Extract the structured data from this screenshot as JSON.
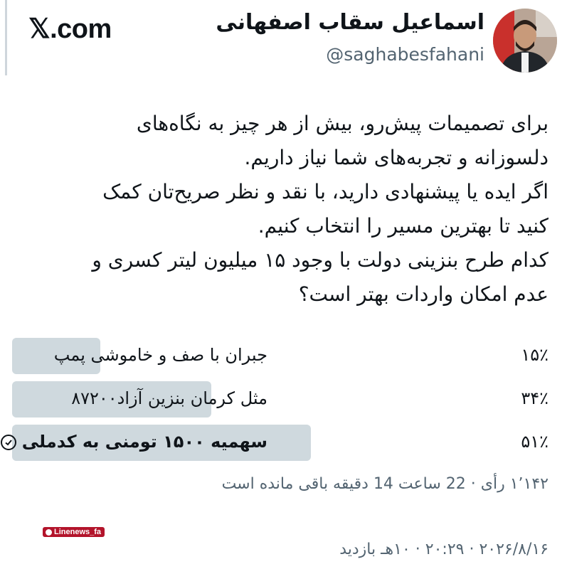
{
  "header": {
    "brand": "𝕏.com",
    "author_name": "اسماعیل سقاب اصفهانی",
    "author_handle": "@saghabesfahani"
  },
  "tweet": {
    "lines": [
      "برای تصمیمات پیش‌رو، بیش از هر چیز به نگاه‌های",
      "دلسوزانه و تجربه‌های شما نیاز داریم.",
      "اگر ایده یا پیشنهادی دارید، با نقد و نظر صریح‌تان کمک",
      "کنید تا بهترین مسیر را انتخاب کنیم.",
      "کدام طرح بنزینی دولت با وجود ۱۵ میلیون لیتر کسری و",
      "عدم امکان واردات بهتر است؟"
    ]
  },
  "poll": {
    "options": [
      {
        "label": "جبران با صف و خاموشی پمپ",
        "percent_text": "۱۵٪",
        "percent": 15,
        "selected": false
      },
      {
        "label": "مثل کرمان بنزین آزاد۸۷۲۰۰",
        "percent_text": "۳۴٪",
        "percent": 34,
        "selected": false
      },
      {
        "label": "سهمیه ۱۵۰۰ تومنی به کدملی",
        "percent_text": "۵۱٪",
        "percent": 51,
        "selected": true
      }
    ],
    "meta": "۱٬۱۴۲ رأی · 22 ساعت 14 دقیقه باقی مانده است"
  },
  "watermark": "Linenews_fa",
  "footer": "۲۰۲۶/۸/۱۶ · ۲۰:۲۹ · ۱۰هـ بازدید",
  "colors": {
    "bar": "#cfd9de",
    "secondary_text": "#536471",
    "watermark_bg": "#b3142b"
  }
}
